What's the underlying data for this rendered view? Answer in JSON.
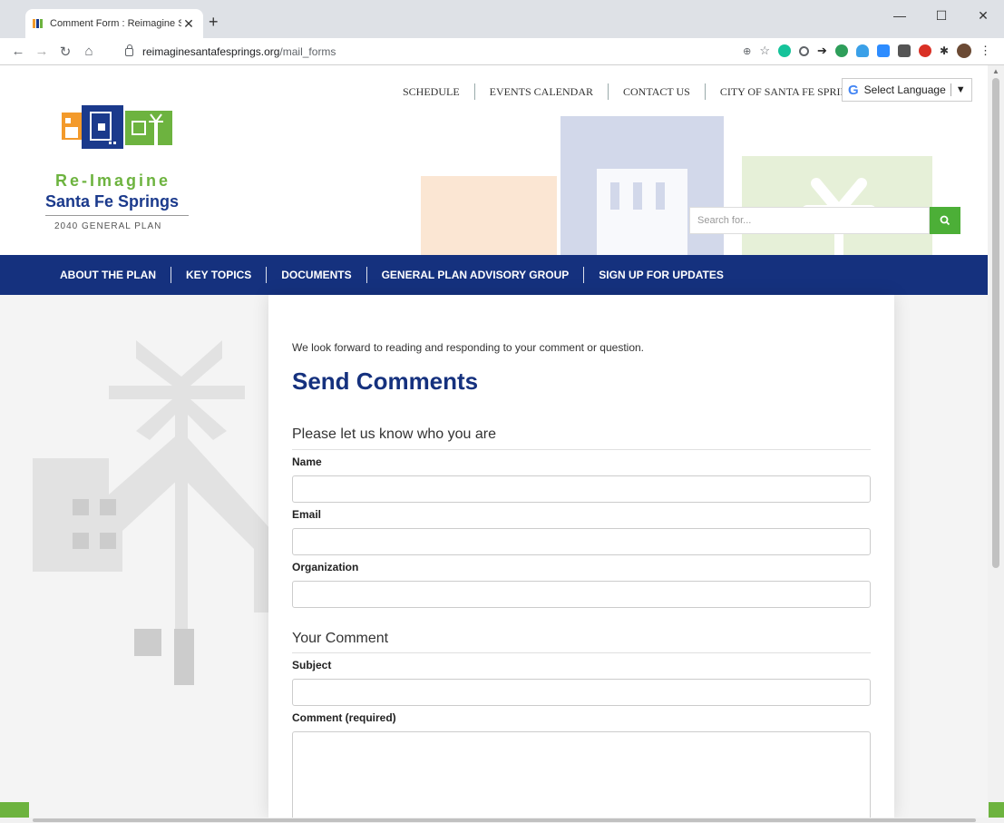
{
  "browser": {
    "tab_title": "Comment Form : Reimagine Sant",
    "url_host": "reimaginesantafesprings.org",
    "url_path": "/mail_forms"
  },
  "header": {
    "top_links": [
      "SCHEDULE",
      "EVENTS CALENDAR",
      "CONTACT US",
      "CITY OF SANTA FE SPRINGS"
    ],
    "language": "Select Language",
    "search_placeholder": "Search for..."
  },
  "logo": {
    "line1": "Re-Imagine",
    "line2": "Santa Fe Springs",
    "line3": "2040 GENERAL PLAN"
  },
  "nav": [
    "ABOUT THE PLAN",
    "KEY TOPICS",
    "DOCUMENTS",
    "GENERAL PLAN ADVISORY GROUP",
    "SIGN UP FOR UPDATES"
  ],
  "form": {
    "intro": "We look forward to reading and responding to your comment or question.",
    "heading": "Send Comments",
    "section1": "Please let us know who you are",
    "name_label": "Name",
    "email_label": "Email",
    "org_label": "Organization",
    "section2": "Your Comment",
    "subject_label": "Subject",
    "comment_label": "Comment (required)"
  },
  "colors": {
    "brand_blue": "#15317e",
    "brand_green": "#6db33f",
    "brand_orange": "#f39a2b"
  }
}
